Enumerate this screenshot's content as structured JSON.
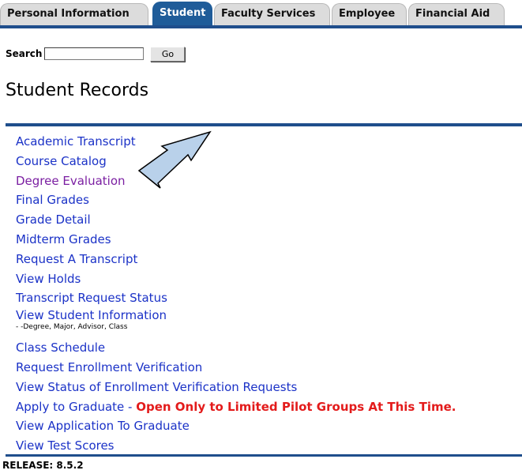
{
  "tabs": [
    {
      "label": "Personal Information",
      "active": false
    },
    {
      "label": "Student",
      "active": true
    },
    {
      "label": "Faculty Services",
      "active": false
    },
    {
      "label": "Employee",
      "active": false
    },
    {
      "label": "Financial Aid",
      "active": false
    }
  ],
  "search": {
    "label": "Search",
    "value": "",
    "go_label": "Go"
  },
  "page_title": "Student Records",
  "menu": {
    "items": [
      {
        "label": "Academic Transcript"
      },
      {
        "label": "Course Catalog"
      },
      {
        "label": "Degree Evaluation",
        "state": "visited"
      },
      {
        "label": "Final Grades"
      },
      {
        "label": "Grade Detail"
      },
      {
        "label": "Midterm Grades"
      },
      {
        "label": "Request A Transcript"
      },
      {
        "label": "View Holds"
      },
      {
        "label": "Transcript Request Status"
      },
      {
        "label": "View Student Information",
        "description": "- -Degree, Major, Advisor, Class"
      },
      {
        "label": "Class Schedule"
      },
      {
        "label": "Request Enrollment Verification"
      },
      {
        "label": "View Status of Enrollment Verification Requests"
      },
      {
        "label": "Apply to Graduate",
        "separator": " - ",
        "note": "Open Only to Limited Pilot Groups At This Time."
      },
      {
        "label": "View Application To Graduate"
      },
      {
        "label": "View Test Scores"
      }
    ]
  },
  "release": "RELEASE: 8.5.2",
  "colors": {
    "brand_blue": "#1f4e8c",
    "active_tab": "#1f5c99",
    "link": "#1b32c7",
    "visited_link": "#7b1fa2",
    "warning": "#e31b1b",
    "arrow_fill": "#b9d1ea"
  }
}
